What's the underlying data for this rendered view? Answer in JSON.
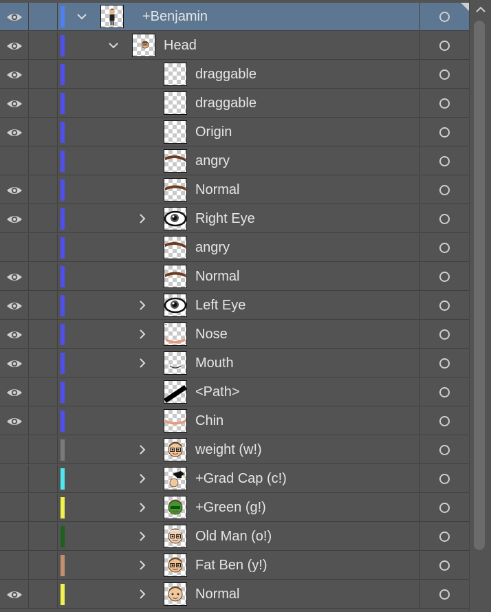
{
  "colors": {
    "panel_bg": "#535353",
    "selected_row": "#5d7792",
    "text": "#e6e6e6",
    "layer_blue": "#4f4ff0",
    "selected_blue": "#4f7ff0"
  },
  "layers": [
    {
      "name": "+Benjamin",
      "visible": true,
      "selected": true,
      "color": "#4f7ff0",
      "expander": "chevron-down-icon",
      "thumb": "figure",
      "level": 0
    },
    {
      "name": "Head",
      "visible": true,
      "selected": false,
      "color": "#4f4ff0",
      "expander": "chevron-down-icon",
      "thumb": "head-small",
      "level": 1
    },
    {
      "name": "draggable",
      "visible": true,
      "selected": false,
      "color": "#4f4ff0",
      "expander": "",
      "thumb": "blank",
      "level": 2
    },
    {
      "name": "draggable",
      "visible": true,
      "selected": false,
      "color": "#4f4ff0",
      "expander": "",
      "thumb": "blank",
      "level": 2
    },
    {
      "name": "Origin",
      "visible": true,
      "selected": false,
      "color": "#4f4ff0",
      "expander": "",
      "thumb": "blank",
      "level": 2
    },
    {
      "name": "angry",
      "visible": false,
      "selected": false,
      "color": "#4f4ff0",
      "expander": "",
      "thumb": "brow-angry",
      "level": 2
    },
    {
      "name": "Normal",
      "visible": true,
      "selected": false,
      "color": "#4f4ff0",
      "expander": "",
      "thumb": "brow-normal",
      "level": 2
    },
    {
      "name": "Right Eye",
      "visible": true,
      "selected": false,
      "color": "#4f4ff0",
      "expander": "chevron-right-icon",
      "thumb": "eye",
      "level": 2
    },
    {
      "name": "angry",
      "visible": false,
      "selected": false,
      "color": "#4f4ff0",
      "expander": "",
      "thumb": "brow-angry",
      "level": 2
    },
    {
      "name": "Normal",
      "visible": true,
      "selected": false,
      "color": "#4f4ff0",
      "expander": "",
      "thumb": "brow-normal",
      "level": 2
    },
    {
      "name": "Left Eye",
      "visible": true,
      "selected": false,
      "color": "#4f4ff0",
      "expander": "chevron-right-icon",
      "thumb": "eye",
      "level": 2
    },
    {
      "name": "Nose",
      "visible": true,
      "selected": false,
      "color": "#4f4ff0",
      "expander": "chevron-right-icon",
      "thumb": "nose",
      "level": 2
    },
    {
      "name": "Mouth",
      "visible": true,
      "selected": false,
      "color": "#4f4ff0",
      "expander": "chevron-right-icon",
      "thumb": "mouth",
      "level": 2
    },
    {
      "name": "<Path>",
      "visible": true,
      "selected": false,
      "color": "#4f4ff0",
      "expander": "",
      "thumb": "path",
      "level": 2
    },
    {
      "name": "Chin",
      "visible": true,
      "selected": false,
      "color": "#4f4ff0",
      "expander": "",
      "thumb": "chin",
      "level": 2
    },
    {
      "name": "weight (w!)",
      "visible": false,
      "selected": false,
      "color": "#7a7a7a",
      "expander": "chevron-right-icon",
      "thumb": "face-glasses",
      "level": 2
    },
    {
      "name": "+Grad Cap (c!)",
      "visible": false,
      "selected": false,
      "color": "#4fe8f0",
      "expander": "chevron-right-icon",
      "thumb": "grad-cap",
      "level": 2
    },
    {
      "name": "+Green (g!)",
      "visible": false,
      "selected": false,
      "color": "#f0f04f",
      "expander": "chevron-right-icon",
      "thumb": "face-green",
      "level": 2
    },
    {
      "name": "Old Man (o!)",
      "visible": false,
      "selected": false,
      "color": "#1f5f1f",
      "expander": "chevron-right-icon",
      "thumb": "face-old",
      "level": 2
    },
    {
      "name": "Fat Ben (y!)",
      "visible": false,
      "selected": false,
      "color": "#c09070",
      "expander": "chevron-right-icon",
      "thumb": "face-fat",
      "level": 2
    },
    {
      "name": "Normal",
      "visible": true,
      "selected": false,
      "color": "#f0f04f",
      "expander": "chevron-right-icon",
      "thumb": "face-normal",
      "level": 2
    }
  ],
  "scrollbar": {
    "up_icon": "scroll-up-icon"
  }
}
